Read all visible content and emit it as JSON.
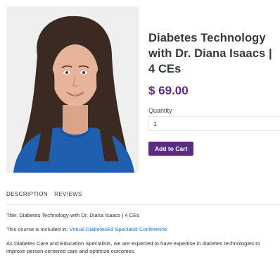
{
  "product": {
    "title": "Diabetes Technology with Dr. Diana Isaacs | 4 CEs",
    "price": "$ 69.00",
    "quantity_label": "Quantity",
    "quantity_value": "1",
    "add_to_cart_label": "Add to Cart"
  },
  "tabs": [
    {
      "label": "DESCRIPTION"
    },
    {
      "label": "REVIEWS"
    }
  ],
  "description": {
    "title_label": "Title:",
    "title_value": "Diabetes Technology with Dr. Diana Isaacs | 4 CEs",
    "included_label": "This course is included in:",
    "included_link": "Virtual DiabetesEd Specialist Conference",
    "intro": "As Diabetes Care and Education Specialists, we are expected to have expertise in diabetes technologies to improve person-centered care and optimize outcomes."
  },
  "colors": {
    "accent": "#5a2d82",
    "link": "#2b6cb0",
    "text": "#333333"
  }
}
